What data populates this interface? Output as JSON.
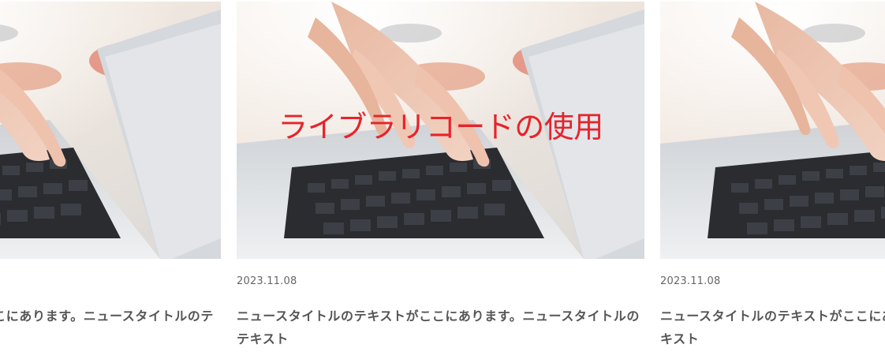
{
  "overlay": {
    "text": "ライブラリコードの使用"
  },
  "cards": [
    {
      "date": "",
      "title": "ニュースタイトルのテキストがここにあります。ニュースタイトルのテ"
    },
    {
      "date": "2023.11.08",
      "title": "ニュースタイトルのテキストがここにあります。ニュースタイトルのテキスト"
    },
    {
      "date": "2023.11.08",
      "title": "ニュースタイトルのテキストがここにあ\nキスト"
    }
  ],
  "colors": {
    "overlay_text": "#e8232a",
    "title_text": "#555555",
    "date_text": "#666666"
  },
  "icons": {
    "thumbnail": "laptop-typing-photo"
  }
}
